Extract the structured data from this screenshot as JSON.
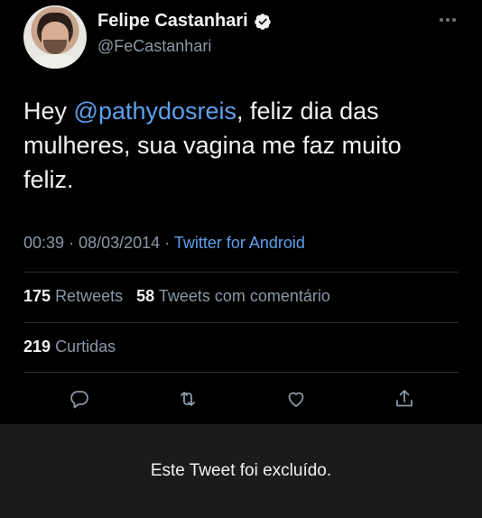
{
  "tweet": {
    "author_name": "Felipe Castanhari",
    "author_handle": "@FeCastanhari",
    "text_before": "Hey ",
    "mention": "@pathydosreis",
    "text_after": ", feliz dia das mulheres,  sua vagina me faz muito feliz.",
    "time": "00:39",
    "date": "08/03/2014",
    "separator": "·",
    "source": "Twitter for Android",
    "retweets_count": "175",
    "retweets_label": "Retweets",
    "quotes_count": "58",
    "quotes_label": "Tweets com comentário",
    "likes_count": "219",
    "likes_label": "Curtidas"
  },
  "icons": {
    "verified": "verified-badge-icon",
    "more": "more-icon",
    "reply": "reply-icon",
    "retweet": "retweet-icon",
    "like": "heart-icon",
    "share": "share-icon"
  },
  "banner": {
    "deleted_text": "Este Tweet foi excluído."
  },
  "colors": {
    "background": "#000000",
    "link": "#5ea0ec",
    "muted": "#8b98a5",
    "banner": "#1b1b1b"
  }
}
